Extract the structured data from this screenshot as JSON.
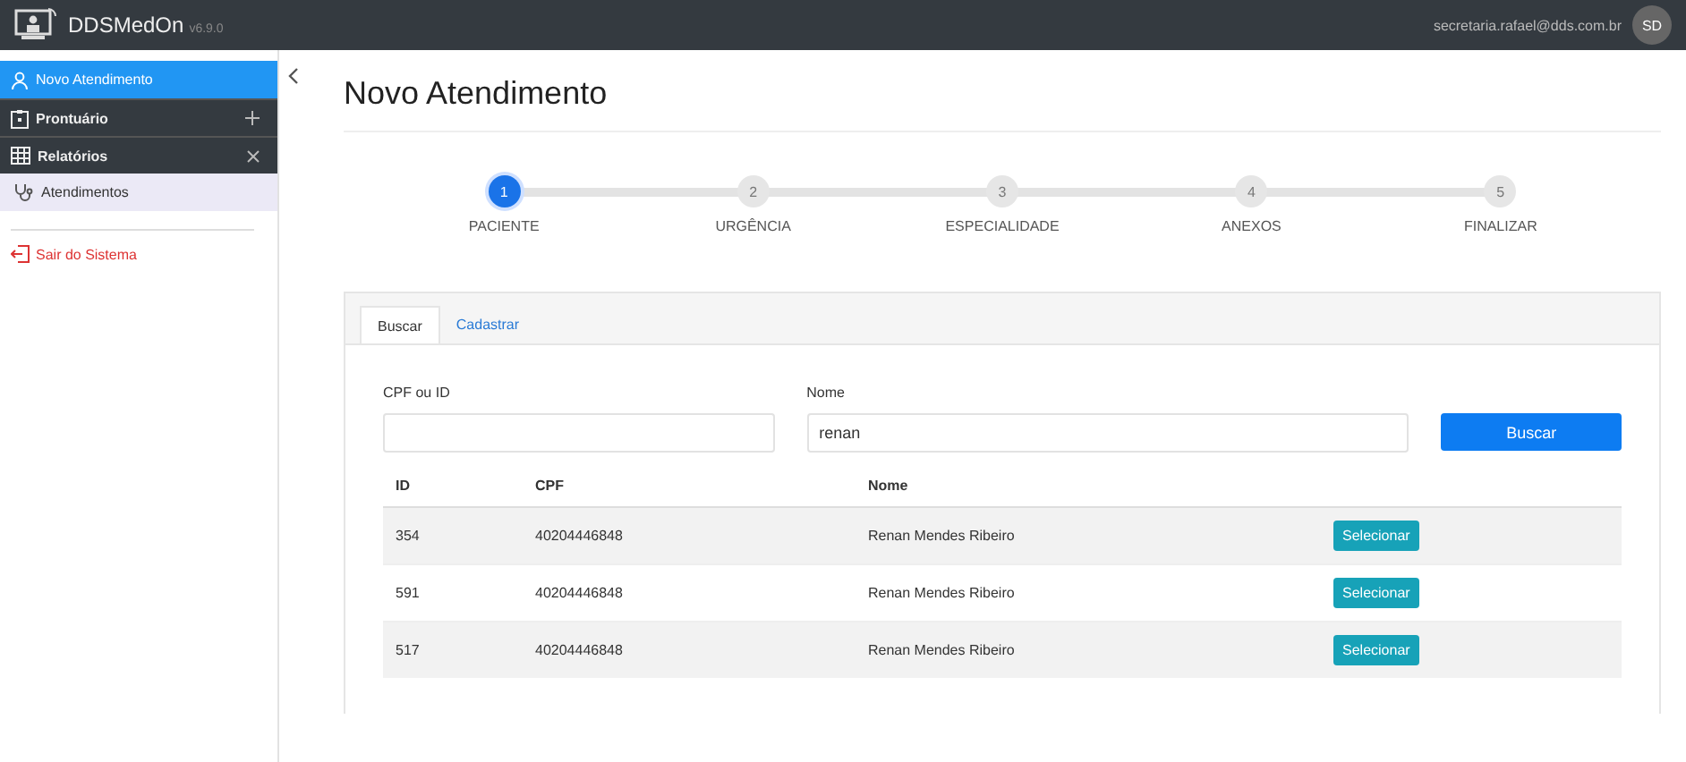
{
  "header": {
    "app_name": "DDSMedOn",
    "version": "v6.9.0",
    "user_email": "secretaria.rafael@dds.com.br",
    "avatar_initials": "SD"
  },
  "sidebar": {
    "items": [
      {
        "kind": "link",
        "label": "Novo Atendimento",
        "selected": true
      },
      {
        "kind": "group",
        "label": "Prontuário",
        "expanded": false
      },
      {
        "kind": "group",
        "label": "Relatórios",
        "expanded": true,
        "children": [
          {
            "label": "Atendimentos",
            "selected": true
          }
        ]
      }
    ],
    "logout": "Sair do Sistema"
  },
  "page_title": "Novo Atendimento",
  "steps": [
    {
      "number": "1",
      "label": "PACIENTE",
      "selected": true
    },
    {
      "number": "2",
      "label": "URGÊNCIA",
      "selected": false
    },
    {
      "number": "3",
      "label": "ESPECIALIDADE",
      "selected": false
    },
    {
      "number": "4",
      "label": "ANEXOS",
      "selected": false
    },
    {
      "number": "5",
      "label": "FINALIZAR",
      "selected": false
    }
  ],
  "tabs": [
    {
      "label": "Buscar",
      "selected": true
    },
    {
      "label": "Cadastrar",
      "selected": false
    }
  ],
  "form": {
    "cpf_label": "CPF ou ID",
    "nome_label": "Nome",
    "nome_value": "renan",
    "search_button": "Buscar"
  },
  "table": {
    "columns": [
      "ID",
      "CPF",
      "Nome"
    ],
    "rows": [
      {
        "id": "354",
        "cpf": "40204446848",
        "nome": "Renan Mendes Ribeiro",
        "action": "Selecionar"
      },
      {
        "id": "591",
        "cpf": "40204446848",
        "nome": "Renan Mendes Ribeiro",
        "action": "Selecionar"
      },
      {
        "id": "517",
        "cpf": "40204446848",
        "nome": "Renan Mendes Ribeiro",
        "action": "Selecionar"
      }
    ]
  }
}
